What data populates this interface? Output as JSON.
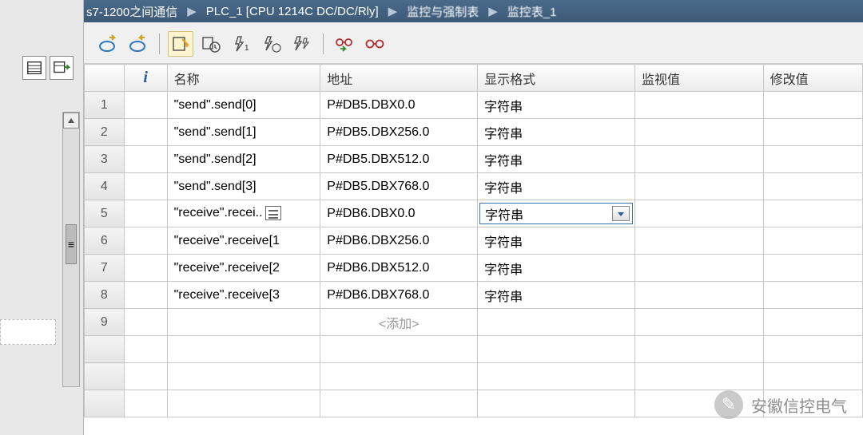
{
  "breadcrumb": {
    "project": "s7-1200之间通信",
    "plc": "PLC_1 [CPU 1214C DC/DC/Rly]",
    "group": "监控与强制表",
    "table": "监控表_1"
  },
  "columns": {
    "i": "i",
    "name": "名称",
    "address": "地址",
    "format": "显示格式",
    "monitor": "监视值",
    "modify": "修改值"
  },
  "rows": [
    {
      "num": "1",
      "name": "\"send\".send[0]",
      "addr": "P#DB5.DBX0.0",
      "fmt": "字符串",
      "mon": "",
      "mod": ""
    },
    {
      "num": "2",
      "name": "\"send\".send[1]",
      "addr": "P#DB5.DBX256.0",
      "fmt": "字符串",
      "mon": "",
      "mod": ""
    },
    {
      "num": "3",
      "name": "\"send\".send[2]",
      "addr": "P#DB5.DBX512.0",
      "fmt": "字符串",
      "mon": "",
      "mod": ""
    },
    {
      "num": "4",
      "name": "\"send\".send[3]",
      "addr": "P#DB5.DBX768.0",
      "fmt": "字符串",
      "mon": "",
      "mod": ""
    },
    {
      "num": "5",
      "name": "\"receive\".recei..",
      "addr": "P#DB6.DBX0.0",
      "fmt": "字符串",
      "mon": "",
      "mod": "",
      "selected": true,
      "name_button": true
    },
    {
      "num": "6",
      "name": "\"receive\".receive[1",
      "addr": "P#DB6.DBX256.0",
      "fmt": "字符串",
      "mon": "",
      "mod": ""
    },
    {
      "num": "7",
      "name": "\"receive\".receive[2",
      "addr": "P#DB6.DBX512.0",
      "fmt": "字符串",
      "mon": "",
      "mod": ""
    },
    {
      "num": "8",
      "name": "\"receive\".receive[3",
      "addr": "P#DB6.DBX768.0",
      "fmt": "字符串",
      "mon": "",
      "mod": ""
    },
    {
      "num": "9",
      "name": "",
      "addr_placeholder": "<添加>",
      "fmt": "",
      "mon": "",
      "mod": ""
    }
  ],
  "watermark": "安徽信控电气"
}
